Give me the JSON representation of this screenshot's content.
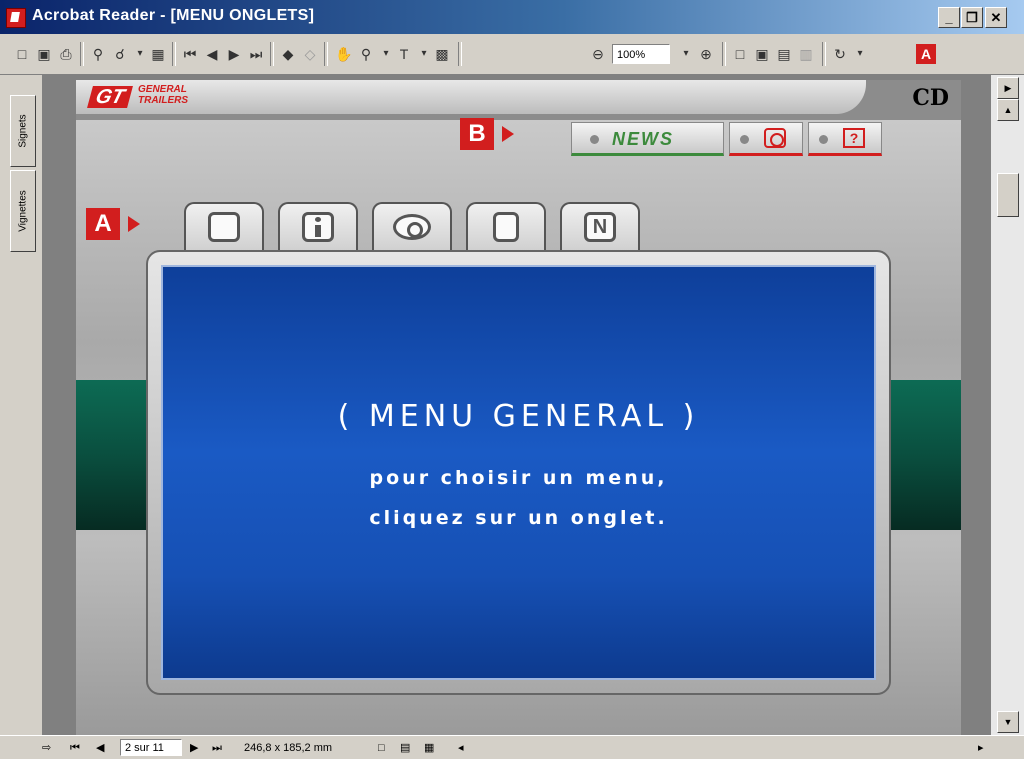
{
  "window": {
    "title": "Acrobat Reader - [MENU ONGLETS]",
    "minimize": "_",
    "restore": "❐",
    "close": "✕"
  },
  "toolbar": {
    "zoom_value": "100%",
    "adobe_icon": "acrobat-logo-icon"
  },
  "side_panel": {
    "tab_bookmarks": "Signets",
    "tab_thumbnails": "Vignettes"
  },
  "document": {
    "brand_logo": "GT",
    "brand_subtitle": "GENERAL TRAILERS",
    "cd_label": "CD",
    "marker_a": "A",
    "marker_b": "B",
    "news_label": "NEWS",
    "help_icon_label": "?",
    "menu_title": "( MENU GENERAL )",
    "menu_line1": "pour choisir un menu,",
    "menu_line2": "cliquez sur un onglet."
  },
  "status": {
    "page_field": "2 sur 11",
    "page_size": "246,8 x 185,2 mm"
  }
}
